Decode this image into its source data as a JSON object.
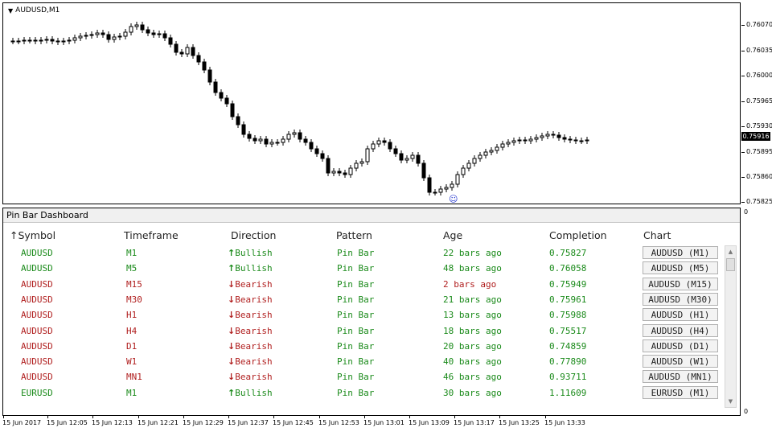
{
  "chart": {
    "title": "AUDUSD,M1",
    "price_labels": [
      "0.76070",
      "0.76035",
      "0.76000",
      "0.75965",
      "0.75930",
      "0.75895",
      "0.75860",
      "0.75825"
    ],
    "current_price": "0.75916",
    "panel_zero_labels": [
      "0",
      "0"
    ],
    "time_labels": [
      "15 Jun 2017",
      "15 Jun 12:05",
      "15 Jun 12:13",
      "15 Jun 12:21",
      "15 Jun 12:29",
      "15 Jun 12:37",
      "15 Jun 12:45",
      "15 Jun 12:53",
      "15 Jun 13:01",
      "15 Jun 13:09",
      "15 Jun 13:17",
      "15 Jun 13:25",
      "15 Jun 13:33"
    ],
    "marker_icon": "smiley-icon"
  },
  "dashboard": {
    "title": "Pin Bar Dashboard",
    "headers": {
      "symbol": "↑Symbol",
      "timeframe": "Timeframe",
      "direction": "Direction",
      "pattern": "Pattern",
      "age": "Age",
      "completion": "Completion",
      "chart": "Chart"
    },
    "colors": {
      "bullish": "#1a8a1a",
      "bearish": "#b01e1e"
    },
    "rows": [
      {
        "symbol": "AUDUSD",
        "tf": "M1",
        "dir": "Bullish",
        "pattern": "Pin Bar",
        "age": "22 bars ago",
        "completion": "0.75827",
        "button": "AUDUSD (M1)",
        "symbolColor": "green",
        "tfColor": "green",
        "ageColor": "green"
      },
      {
        "symbol": "AUDUSD",
        "tf": "M5",
        "dir": "Bullish",
        "pattern": "Pin Bar",
        "age": "48 bars ago",
        "completion": "0.76058",
        "button": "AUDUSD (M5)",
        "symbolColor": "green",
        "tfColor": "green",
        "ageColor": "green"
      },
      {
        "symbol": "AUDUSD",
        "tf": "M15",
        "dir": "Bearish",
        "pattern": "Pin Bar",
        "age": "2 bars ago",
        "completion": "0.75949",
        "button": "AUDUSD (M15)",
        "symbolColor": "red",
        "tfColor": "red",
        "ageColor": "red"
      },
      {
        "symbol": "AUDUSD",
        "tf": "M30",
        "dir": "Bearish",
        "pattern": "Pin Bar",
        "age": "21 bars ago",
        "completion": "0.75961",
        "button": "AUDUSD (M30)",
        "symbolColor": "red",
        "tfColor": "red",
        "ageColor": "green"
      },
      {
        "symbol": "AUDUSD",
        "tf": "H1",
        "dir": "Bearish",
        "pattern": "Pin Bar",
        "age": "13 bars ago",
        "completion": "0.75988",
        "button": "AUDUSD (H1)",
        "symbolColor": "red",
        "tfColor": "red",
        "ageColor": "green"
      },
      {
        "symbol": "AUDUSD",
        "tf": "H4",
        "dir": "Bearish",
        "pattern": "Pin Bar",
        "age": "18 bars ago",
        "completion": "0.75517",
        "button": "AUDUSD (H4)",
        "symbolColor": "red",
        "tfColor": "red",
        "ageColor": "green"
      },
      {
        "symbol": "AUDUSD",
        "tf": "D1",
        "dir": "Bearish",
        "pattern": "Pin Bar",
        "age": "20 bars ago",
        "completion": "0.74859",
        "button": "AUDUSD (D1)",
        "symbolColor": "red",
        "tfColor": "red",
        "ageColor": "green"
      },
      {
        "symbol": "AUDUSD",
        "tf": "W1",
        "dir": "Bearish",
        "pattern": "Pin Bar",
        "age": "40 bars ago",
        "completion": "0.77890",
        "button": "AUDUSD (W1)",
        "symbolColor": "red",
        "tfColor": "red",
        "ageColor": "green"
      },
      {
        "symbol": "AUDUSD",
        "tf": "MN1",
        "dir": "Bearish",
        "pattern": "Pin Bar",
        "age": "46 bars ago",
        "completion": "0.93711",
        "button": "AUDUSD (MN1)",
        "symbolColor": "red",
        "tfColor": "red",
        "ageColor": "green"
      },
      {
        "symbol": "EURUSD",
        "tf": "M1",
        "dir": "Bullish",
        "pattern": "Pin Bar",
        "age": "30 bars ago",
        "completion": "1.11609",
        "button": "EURUSD (M1)",
        "symbolColor": "green",
        "tfColor": "green",
        "ageColor": "green"
      }
    ]
  }
}
